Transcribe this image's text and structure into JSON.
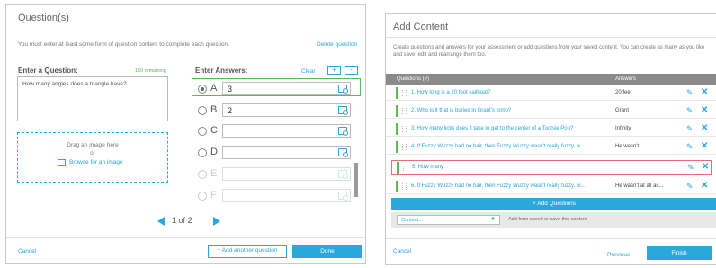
{
  "left_panel": {
    "title": "Question(s)",
    "instructions": "You must enter at least some form of question content to complete each question.",
    "delete_label": "Delete question",
    "enter_question_label": "Enter a Question:",
    "remaining_label": "150 remaining",
    "question_text": "How many angles does a triangle have?",
    "drag_text": "Drag an image here",
    "or_text": "or",
    "browse_text": "Browse for an image",
    "enter_answers_label": "Enter Answers:",
    "clear_label": "Clear",
    "plus_label": "+",
    "minus_label": "-",
    "answers": [
      {
        "letter": "A",
        "value": "3",
        "selected": true,
        "disabled": false
      },
      {
        "letter": "B",
        "value": "2",
        "selected": false,
        "disabled": false
      },
      {
        "letter": "C",
        "value": "",
        "selected": false,
        "disabled": false
      },
      {
        "letter": "D",
        "value": "",
        "selected": false,
        "disabled": false
      },
      {
        "letter": "E",
        "value": "",
        "selected": false,
        "disabled": true
      },
      {
        "letter": "F",
        "value": "",
        "selected": false,
        "disabled": true
      }
    ],
    "pager": {
      "current": "1",
      "of_text": "of",
      "total": "2"
    },
    "cancel_label": "Cancel",
    "add_another_label": "+ Add another question",
    "done_label": "Done"
  },
  "right_panel": {
    "title": "Add Content",
    "instructions": "Create questions and answers for your assessment or add questions from your saved content. You can create as many as you like and save, edit and rearrange them too.",
    "col_questions": "Questions (#)",
    "col_answers": "Answers",
    "rows": [
      {
        "question": "1. How long is a 20 foot sailboat?",
        "answer": "20 feet",
        "highlight": false
      },
      {
        "question": "2. Who is it that is buried in Grant's tomb?",
        "answer": "Grant",
        "highlight": false
      },
      {
        "question": "3. How many licks does it take to get to the center of a Tootsie Pop?",
        "answer": "Infinity",
        "highlight": false
      },
      {
        "question": "4. If Fuzzy Wuzzy had no hair, then Fuzzy Wuzzy wasn't really fuzzy, w...",
        "answer": "He wasn't",
        "highlight": false
      },
      {
        "question": "5. How many",
        "answer": "",
        "highlight": true
      },
      {
        "question": "6. If Fuzzy Wuzzy had no hair, then Fuzzy Wuzzy wasn't really fuzzy, w...",
        "answer": "He wasn't at all ac...",
        "highlight": false
      }
    ],
    "add_questions_label": "+ Add Questions",
    "content_select_value": "Content...",
    "add_from_saved_text": "Add from saved or save this content",
    "cancel_label": "Cancel",
    "previous_label": "Previous",
    "finish_label": "Finish"
  },
  "colors": {
    "accent": "#2ba7dc",
    "correct_green": "#5cb85c",
    "highlight_red": "#e0707a",
    "table_header": "#8a8a8a"
  }
}
